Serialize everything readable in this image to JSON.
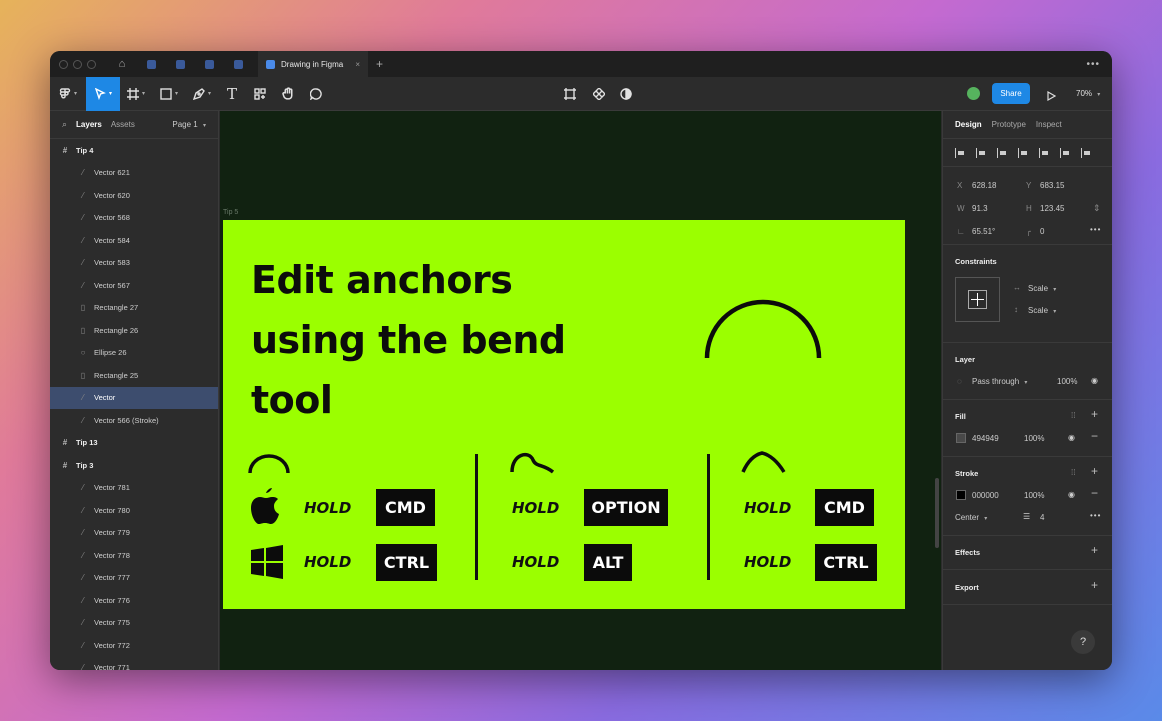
{
  "titlebar": {
    "active_tab": "Drawing in Figma",
    "close": "×",
    "new_tab": "+",
    "more": "•••"
  },
  "toolbar": {
    "share": "Share",
    "zoom": "70%",
    "tools": [
      "main-menu",
      "move",
      "frame",
      "shape",
      "pen",
      "text",
      "resources",
      "hand",
      "comment"
    ]
  },
  "left_panel": {
    "tabs": [
      "Layers",
      "Assets"
    ],
    "page": "Page 1",
    "layers": [
      {
        "name": "Tip 4",
        "kind": "frame"
      },
      {
        "name": "Vector 621",
        "kind": "vector"
      },
      {
        "name": "Vector 620",
        "kind": "vector"
      },
      {
        "name": "Vector 568",
        "kind": "vector"
      },
      {
        "name": "Vector 584",
        "kind": "vector"
      },
      {
        "name": "Vector 583",
        "kind": "vector"
      },
      {
        "name": "Vector 567",
        "kind": "vector"
      },
      {
        "name": "Rectangle 27",
        "kind": "rect"
      },
      {
        "name": "Rectangle 26",
        "kind": "rect"
      },
      {
        "name": "Ellipse 26",
        "kind": "ellipse"
      },
      {
        "name": "Rectangle 25",
        "kind": "rect"
      },
      {
        "name": "Vector",
        "kind": "vector",
        "selected": true
      },
      {
        "name": "Vector 566 (Stroke)",
        "kind": "vector"
      },
      {
        "name": "Tip 13",
        "kind": "frame"
      },
      {
        "name": "Tip 3",
        "kind": "frame"
      },
      {
        "name": "Vector 781",
        "kind": "vector"
      },
      {
        "name": "Vector 780",
        "kind": "vector"
      },
      {
        "name": "Vector 779",
        "kind": "vector"
      },
      {
        "name": "Vector 778",
        "kind": "vector"
      },
      {
        "name": "Vector 777",
        "kind": "vector"
      },
      {
        "name": "Vector 776",
        "kind": "vector"
      },
      {
        "name": "Vector 775",
        "kind": "vector"
      },
      {
        "name": "Vector 772",
        "kind": "vector"
      },
      {
        "name": "Vector 771",
        "kind": "vector"
      }
    ]
  },
  "canvas": {
    "frame_label": "Tip 5",
    "headline": "Edit anchors using the bend tool",
    "hold": "HOLD",
    "keys": {
      "cmd": "CMD",
      "ctrl": "CTRL",
      "option": "OPTION",
      "alt": "ALT"
    },
    "artboard_color": "#9BFF00"
  },
  "right_panel": {
    "tabs": [
      "Design",
      "Prototype",
      "Inspect"
    ],
    "x_label": "X",
    "x": "628.18",
    "y_label": "Y",
    "y": "683.15",
    "w_label": "W",
    "w": "91.3",
    "h_label": "H",
    "h": "123.45",
    "rotation": "65.51°",
    "radius": "0",
    "constraints_title": "Constraints",
    "constraint_h": "Scale",
    "constraint_v": "Scale",
    "layer_title": "Layer",
    "blend": "Pass through",
    "layer_opacity": "100%",
    "fill_title": "Fill",
    "fill_hex": "494949",
    "fill_opacity": "100%",
    "fill_color": "#494949",
    "stroke_title": "Stroke",
    "stroke_hex": "000000",
    "stroke_opacity": "100%",
    "stroke_color": "#000000",
    "stroke_align": "Center",
    "stroke_weight": "4",
    "effects_title": "Effects",
    "export_title": "Export",
    "help": "?"
  }
}
